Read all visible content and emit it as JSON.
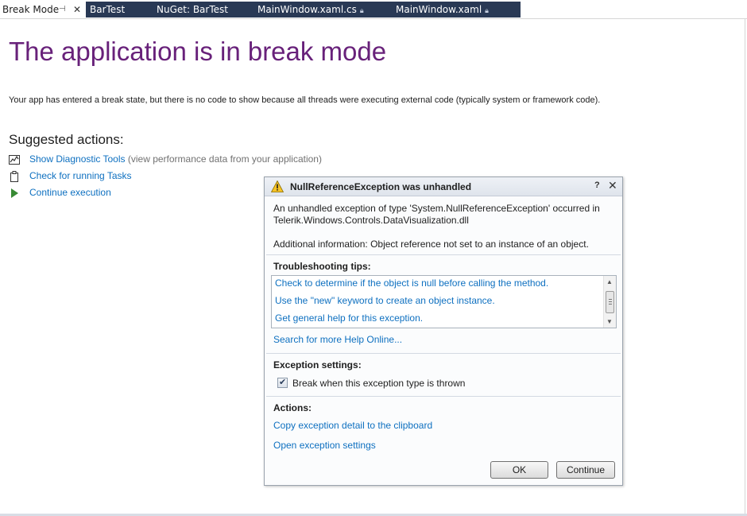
{
  "tabs": [
    {
      "label": "Break Mode",
      "active": true
    },
    {
      "label": "BarTest",
      "active": false
    },
    {
      "label": "NuGet: BarTest",
      "active": false
    },
    {
      "label": "MainWindow.xaml.cs",
      "active": false,
      "locked": true
    },
    {
      "label": "MainWindow.xaml",
      "active": false,
      "locked": true
    }
  ],
  "page": {
    "title": "The application is in break mode",
    "description": "Your app has entered a break state, but there is no code to show because all threads were executing external code (typically system or framework code).",
    "suggested_heading": "Suggested actions:",
    "actions": [
      {
        "label": "Show Diagnostic Tools",
        "note": "(view performance data from your application)",
        "icon": "diagnostic-chart-icon"
      },
      {
        "label": "Check for running Tasks",
        "note": "",
        "icon": "clipboard-icon"
      },
      {
        "label": "Continue execution",
        "note": "",
        "icon": "play-icon"
      }
    ]
  },
  "dialog": {
    "title": "NullReferenceException was unhandled",
    "help_glyph": "?",
    "close_glyph": "✕",
    "message_line1": "An unhandled exception of type 'System.NullReferenceException' occurred in",
    "message_line2": "Telerik.Windows.Controls.DataVisualization.dll",
    "additional": "Additional information: Object reference not set to an instance of an object.",
    "tips_heading": "Troubleshooting tips:",
    "tips": [
      "Check to determine if the object is null before calling the method.",
      "Use the \"new\" keyword to create an object instance.",
      "Get general help for this exception."
    ],
    "search_more": "Search for more Help Online...",
    "exception_settings_heading": "Exception settings:",
    "break_checkbox_label": "Break when this exception type is thrown",
    "break_checked": true,
    "actions_heading": "Actions:",
    "copy_detail": "Copy exception detail to the clipboard",
    "open_settings": "Open exception settings",
    "ok_label": "OK",
    "continue_label": "Continue"
  },
  "colors": {
    "title_purple": "#68217a",
    "link_blue": "#0e70c0",
    "tab_bar": "#293955",
    "play_green": "#388a34",
    "warning_yellow": "#f7c325"
  }
}
